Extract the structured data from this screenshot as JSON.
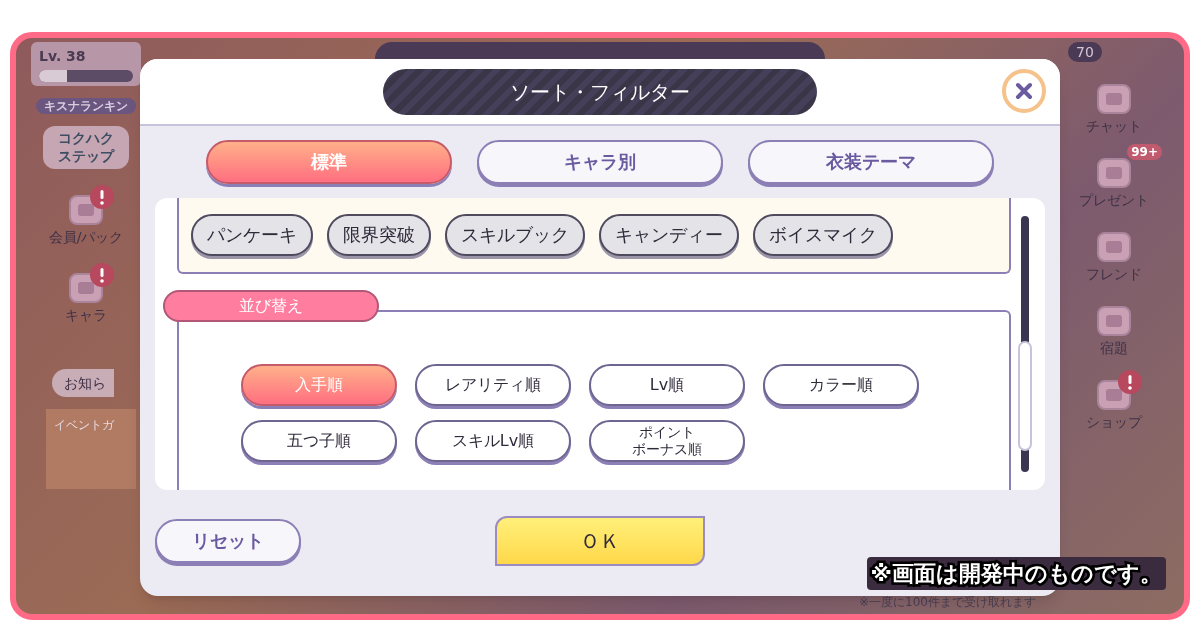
{
  "background": {
    "level_label": "Lv. 38",
    "level": 0.3,
    "ranking": "キスナランキン",
    "kokuhaku": "コクハクステップ",
    "count": "70",
    "left_menu": [
      {
        "label": "会員/パック",
        "alert": true
      },
      {
        "label": "キャラ",
        "alert": true
      }
    ],
    "notice": "お知ら",
    "event_banner": "イベントガ",
    "right_menu": [
      {
        "label": "チャット",
        "alert": false
      },
      {
        "label": "プレゼント",
        "badge": "99+",
        "alert": false
      },
      {
        "label": "フレンド",
        "alert": false
      },
      {
        "label": "宿題",
        "alert": false
      },
      {
        "label": "ショップ",
        "alert": true
      }
    ],
    "footer_note": "※一度に100件まで受け取れます"
  },
  "dialog": {
    "title": "ソート・フィルター",
    "tabs": [
      {
        "label": "標準",
        "selected": true
      },
      {
        "label": "キャラ別",
        "selected": false
      },
      {
        "label": "衣装テーマ",
        "selected": false
      }
    ],
    "filter_chips": [
      "パンケーキ",
      "限界突破",
      "スキルブック",
      "キャンディー",
      "ボイスマイク"
    ],
    "sort_section": "並び替え",
    "sort_options": [
      {
        "lines": [
          "入手順"
        ],
        "selected": true
      },
      {
        "lines": [
          "レアリティ順"
        ],
        "selected": false
      },
      {
        "lines": [
          "Lv順"
        ],
        "selected": false
      },
      {
        "lines": [
          "カラー順"
        ],
        "selected": false
      },
      {
        "lines": [
          "五つ子順"
        ],
        "selected": false
      },
      {
        "lines": [
          "スキルLv順"
        ],
        "selected": false
      },
      {
        "lines": [
          "ポイント",
          "ボーナス順"
        ],
        "selected": false
      }
    ],
    "reset": "リセット",
    "ok": "ＯＫ"
  },
  "caption": "※画面は開発中のものです。"
}
